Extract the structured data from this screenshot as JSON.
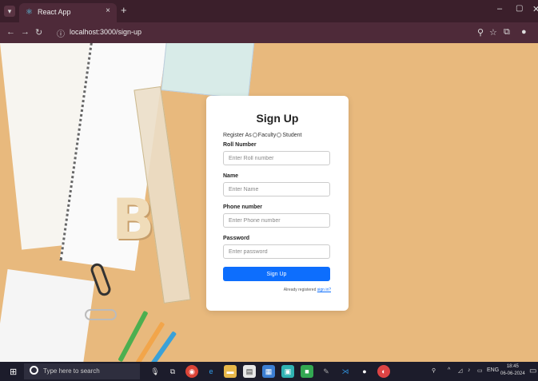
{
  "browser": {
    "tab_title": "React App",
    "tab_close": "×",
    "new_tab": "+",
    "url": "localhost:3000/sign-up",
    "window_minimize": "–",
    "window_maximize": "▢",
    "window_close": "✕"
  },
  "page": {
    "title": "Sign Up",
    "register_as_label": "Register As",
    "roles": [
      "Faculty",
      "Student"
    ],
    "fields": [
      {
        "label": "Roll Number",
        "placeholder": "Enter Roll number"
      },
      {
        "label": "Name",
        "placeholder": "Enter Name"
      },
      {
        "label": "Phone number",
        "placeholder": "Enter Phone number"
      },
      {
        "label": "Password",
        "placeholder": "Enter password"
      }
    ],
    "submit_label": "Sign Up",
    "already_registered_text": "Already registered",
    "sign_in_link": "sign in?"
  },
  "taskbar": {
    "search_placeholder": "Type here to search",
    "language": "ENG",
    "time": "18:45",
    "date": "06-06-2024"
  },
  "colors": {
    "accent": "#0d6efd",
    "background": "#e8b97d",
    "browser_chrome": "#4e2a39"
  }
}
